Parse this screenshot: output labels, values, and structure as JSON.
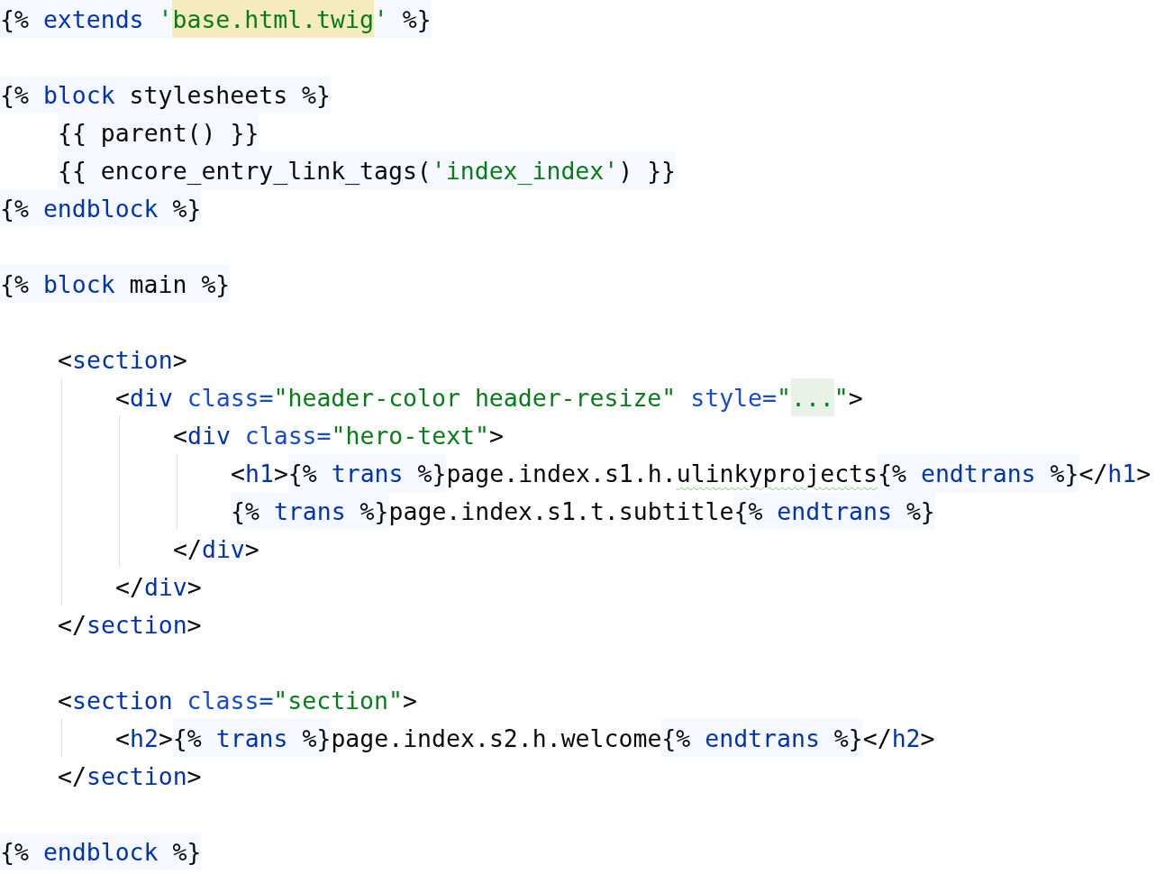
{
  "editor": {
    "lines": [
      {
        "kind": "code",
        "segments": [
          {
            "kind": "twig",
            "tokens": [
              {
                "kind": "punct",
                "text": "{% "
              },
              {
                "kind": "keyword",
                "text": "extends "
              },
              {
                "kind": "string",
                "text": "'"
              },
              {
                "kind": "match",
                "text": "base.html.twig"
              },
              {
                "kind": "string",
                "text": "'"
              },
              {
                "kind": "punct",
                "text": " %}"
              }
            ]
          }
        ]
      },
      {
        "kind": "blank"
      },
      {
        "kind": "code",
        "segments": [
          {
            "kind": "twig",
            "tokens": [
              {
                "kind": "punct",
                "text": "{% "
              },
              {
                "kind": "keyword",
                "text": "block"
              },
              {
                "kind": "punct",
                "text": " stylesheets %}"
              }
            ]
          }
        ],
        "children": [
          {
            "kind": "code",
            "segments": [
              {
                "kind": "twig",
                "tokens": [
                  {
                    "kind": "punct",
                    "text": "{{ parent() }}"
                  }
                ]
              }
            ]
          },
          {
            "kind": "code",
            "segments": [
              {
                "kind": "twig",
                "tokens": [
                  {
                    "kind": "punct",
                    "text": "{{ encore_entry_link_tags("
                  },
                  {
                    "kind": "string",
                    "text": "'index_index'"
                  },
                  {
                    "kind": "punct",
                    "text": ") }}"
                  }
                ]
              }
            ]
          }
        ]
      },
      {
        "kind": "code",
        "segments": [
          {
            "kind": "twig",
            "tokens": [
              {
                "kind": "punct",
                "text": "{% "
              },
              {
                "kind": "keyword",
                "text": "endblock"
              },
              {
                "kind": "punct",
                "text": " %}"
              }
            ]
          }
        ]
      },
      {
        "kind": "blank"
      },
      {
        "kind": "code",
        "segments": [
          {
            "kind": "twig",
            "tokens": [
              {
                "kind": "punct",
                "text": "{% "
              },
              {
                "kind": "keyword",
                "text": "block"
              },
              {
                "kind": "punct",
                "text": " main %}"
              }
            ]
          }
        ],
        "children": [
          {
            "kind": "blank"
          },
          {
            "kind": "code",
            "segments": [
              {
                "kind": "plain",
                "tokens": [
                  {
                    "kind": "punct",
                    "text": "<"
                  },
                  {
                    "kind": "keyword",
                    "text": "section"
                  },
                  {
                    "kind": "punct",
                    "text": ">"
                  }
                ]
              }
            ],
            "children": [
              {
                "kind": "code",
                "segments": [
                  {
                    "kind": "plain",
                    "tokens": [
                      {
                        "kind": "punct",
                        "text": "<"
                      },
                      {
                        "kind": "keyword",
                        "text": "div"
                      },
                      {
                        "kind": "attr",
                        "text": " class="
                      },
                      {
                        "kind": "string",
                        "text": "\"header-color header-resize\""
                      },
                      {
                        "kind": "attr",
                        "text": " style="
                      },
                      {
                        "kind": "string",
                        "text": "\""
                      },
                      {
                        "kind": "fold",
                        "text": "..."
                      },
                      {
                        "kind": "string",
                        "text": "\""
                      },
                      {
                        "kind": "punct",
                        "text": ">"
                      }
                    ]
                  }
                ],
                "children": [
                  {
                    "kind": "code",
                    "segments": [
                      {
                        "kind": "plain",
                        "tokens": [
                          {
                            "kind": "punct",
                            "text": "<"
                          },
                          {
                            "kind": "keyword",
                            "text": "div"
                          },
                          {
                            "kind": "attr",
                            "text": " class="
                          },
                          {
                            "kind": "string",
                            "text": "\"hero-text\""
                          },
                          {
                            "kind": "punct",
                            "text": ">"
                          }
                        ]
                      }
                    ],
                    "children": [
                      {
                        "kind": "code",
                        "segments": [
                          {
                            "kind": "plain",
                            "tokens": [
                              {
                                "kind": "punct",
                                "text": "<"
                              },
                              {
                                "kind": "keyword",
                                "text": "h1"
                              },
                              {
                                "kind": "punct",
                                "text": ">"
                              }
                            ]
                          },
                          {
                            "kind": "twig",
                            "tokens": [
                              {
                                "kind": "punct",
                                "text": "{% "
                              },
                              {
                                "kind": "keyword",
                                "text": "trans"
                              },
                              {
                                "kind": "punct",
                                "text": " %}"
                              }
                            ]
                          },
                          {
                            "kind": "plain",
                            "tokens": [
                              {
                                "kind": "punct",
                                "text": "page.index.s1.h."
                              },
                              {
                                "kind": "typo",
                                "text": "ulinkyprojects"
                              }
                            ]
                          },
                          {
                            "kind": "twig",
                            "tokens": [
                              {
                                "kind": "punct",
                                "text": "{% "
                              },
                              {
                                "kind": "keyword",
                                "text": "endtrans"
                              },
                              {
                                "kind": "punct",
                                "text": " %}"
                              }
                            ]
                          },
                          {
                            "kind": "plain",
                            "tokens": [
                              {
                                "kind": "punct",
                                "text": "</"
                              },
                              {
                                "kind": "keyword",
                                "text": "h1"
                              },
                              {
                                "kind": "punct",
                                "text": ">"
                              }
                            ]
                          }
                        ]
                      },
                      {
                        "kind": "code",
                        "segments": [
                          {
                            "kind": "twig",
                            "tokens": [
                              {
                                "kind": "punct",
                                "text": "{% "
                              },
                              {
                                "kind": "keyword",
                                "text": "trans"
                              },
                              {
                                "kind": "punct",
                                "text": " %}"
                              }
                            ]
                          },
                          {
                            "kind": "plain",
                            "tokens": [
                              {
                                "kind": "punct",
                                "text": "page.index.s1.t.subtitle"
                              }
                            ]
                          },
                          {
                            "kind": "twig",
                            "tokens": [
                              {
                                "kind": "punct",
                                "text": "{% "
                              },
                              {
                                "kind": "keyword",
                                "text": "endtrans"
                              },
                              {
                                "kind": "punct",
                                "text": " %}"
                              }
                            ]
                          }
                        ]
                      }
                    ]
                  },
                  {
                    "kind": "code",
                    "segments": [
                      {
                        "kind": "plain",
                        "tokens": [
                          {
                            "kind": "punct",
                            "text": "</"
                          },
                          {
                            "kind": "keyword",
                            "text": "div"
                          },
                          {
                            "kind": "punct",
                            "text": ">"
                          }
                        ]
                      }
                    ]
                  }
                ]
              },
              {
                "kind": "code",
                "segments": [
                  {
                    "kind": "plain",
                    "tokens": [
                      {
                        "kind": "punct",
                        "text": "</"
                      },
                      {
                        "kind": "keyword",
                        "text": "div"
                      },
                      {
                        "kind": "punct",
                        "text": ">"
                      }
                    ]
                  }
                ]
              }
            ]
          },
          {
            "kind": "code",
            "segments": [
              {
                "kind": "plain",
                "tokens": [
                  {
                    "kind": "punct",
                    "text": "</"
                  },
                  {
                    "kind": "keyword",
                    "text": "section"
                  },
                  {
                    "kind": "punct",
                    "text": ">"
                  }
                ]
              }
            ]
          },
          {
            "kind": "blank"
          },
          {
            "kind": "code",
            "segments": [
              {
                "kind": "plain",
                "tokens": [
                  {
                    "kind": "punct",
                    "text": "<"
                  },
                  {
                    "kind": "keyword",
                    "text": "section"
                  },
                  {
                    "kind": "attr",
                    "text": " class="
                  },
                  {
                    "kind": "string",
                    "text": "\"section\""
                  },
                  {
                    "kind": "punct",
                    "text": ">"
                  }
                ]
              }
            ],
            "children": [
              {
                "kind": "code",
                "segments": [
                  {
                    "kind": "plain",
                    "tokens": [
                      {
                        "kind": "punct",
                        "text": "<"
                      },
                      {
                        "kind": "keyword",
                        "text": "h2"
                      },
                      {
                        "kind": "punct",
                        "text": ">"
                      }
                    ]
                  },
                  {
                    "kind": "twig",
                    "tokens": [
                      {
                        "kind": "punct",
                        "text": "{% "
                      },
                      {
                        "kind": "keyword",
                        "text": "trans"
                      },
                      {
                        "kind": "punct",
                        "text": " %}"
                      }
                    ]
                  },
                  {
                    "kind": "plain",
                    "tokens": [
                      {
                        "kind": "punct",
                        "text": "page.index.s2.h.welcome"
                      }
                    ]
                  },
                  {
                    "kind": "twig",
                    "tokens": [
                      {
                        "kind": "punct",
                        "text": "{% "
                      },
                      {
                        "kind": "keyword",
                        "text": "endtrans"
                      },
                      {
                        "kind": "punct",
                        "text": " %}"
                      }
                    ]
                  },
                  {
                    "kind": "plain",
                    "tokens": [
                      {
                        "kind": "punct",
                        "text": "</"
                      },
                      {
                        "kind": "keyword",
                        "text": "h2"
                      },
                      {
                        "kind": "punct",
                        "text": ">"
                      }
                    ]
                  }
                ]
              }
            ]
          },
          {
            "kind": "code",
            "segments": [
              {
                "kind": "plain",
                "tokens": [
                  {
                    "kind": "punct",
                    "text": "</"
                  },
                  {
                    "kind": "keyword",
                    "text": "section"
                  },
                  {
                    "kind": "punct",
                    "text": ">"
                  }
                ]
              }
            ]
          },
          {
            "kind": "blank"
          }
        ]
      },
      {
        "kind": "code",
        "segments": [
          {
            "kind": "twig",
            "tokens": [
              {
                "kind": "punct",
                "text": "{% "
              },
              {
                "kind": "keyword",
                "text": "endblock"
              },
              {
                "kind": "punct",
                "text": " %}"
              }
            ]
          }
        ]
      }
    ]
  }
}
